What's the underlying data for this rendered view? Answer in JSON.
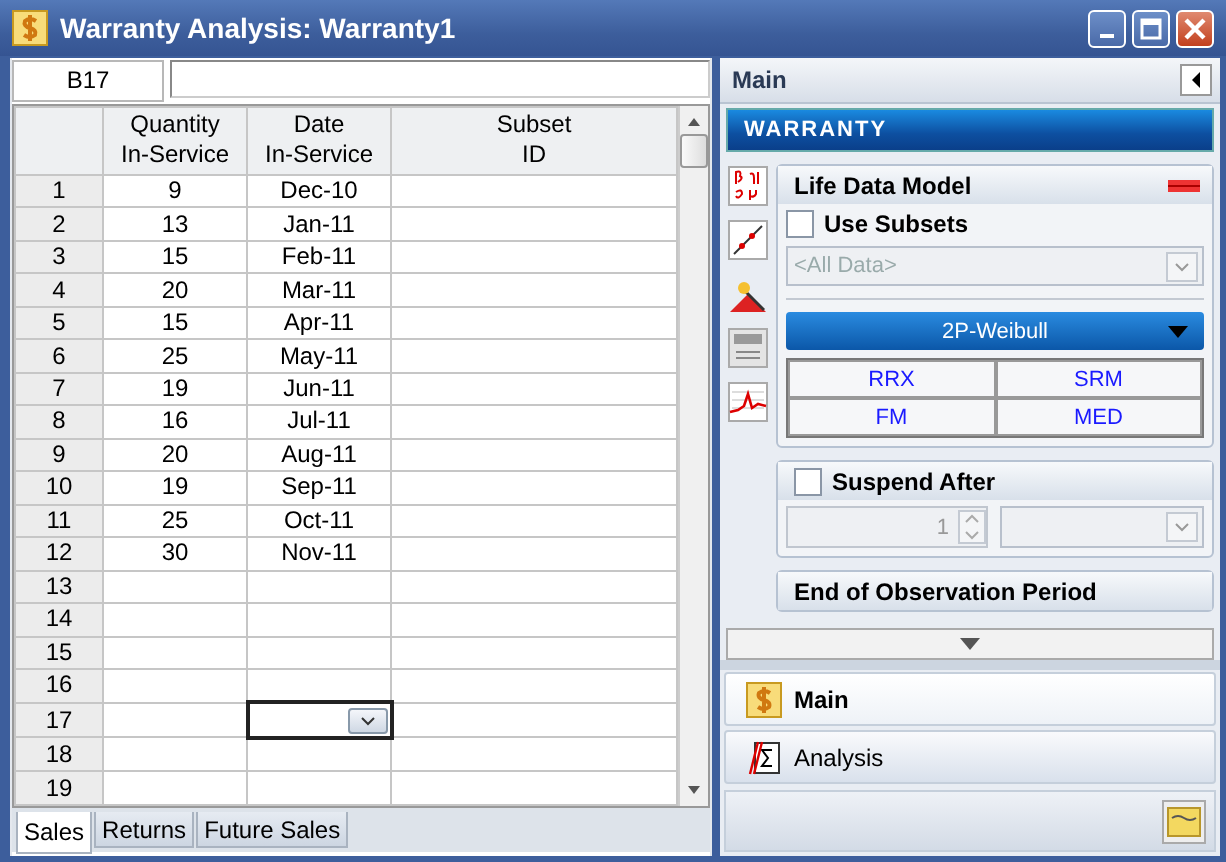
{
  "window": {
    "title": "Warranty Analysis: Warranty1"
  },
  "cell_reference": {
    "name": "B17"
  },
  "table": {
    "columns": [
      {
        "lines": [
          "Quantity",
          "In-Service"
        ]
      },
      {
        "lines": [
          "Date",
          "In-Service"
        ]
      },
      {
        "lines": [
          "Subset",
          "ID"
        ]
      }
    ],
    "rows": [
      {
        "row": "1",
        "quantity": "9",
        "date": "Dec-10",
        "selected": false
      },
      {
        "row": "2",
        "quantity": "13",
        "date": "Jan-11",
        "selected": false
      },
      {
        "row": "3",
        "quantity": "15",
        "date": "Feb-11",
        "selected": false
      },
      {
        "row": "4",
        "quantity": "20",
        "date": "Mar-11",
        "selected": false
      },
      {
        "row": "5",
        "quantity": "15",
        "date": "Apr-11",
        "selected": false
      },
      {
        "row": "6",
        "quantity": "25",
        "date": "May-11",
        "selected": false
      },
      {
        "row": "7",
        "quantity": "19",
        "date": "Jun-11",
        "selected": false
      },
      {
        "row": "8",
        "quantity": "16",
        "date": "Jul-11",
        "selected": false
      },
      {
        "row": "9",
        "quantity": "20",
        "date": "Aug-11",
        "selected": false
      },
      {
        "row": "10",
        "quantity": "19",
        "date": "Sep-11",
        "selected": false
      },
      {
        "row": "11",
        "quantity": "25",
        "date": "Oct-11",
        "selected": false
      },
      {
        "row": "12",
        "quantity": "30",
        "date": "Nov-11",
        "selected": false
      },
      {
        "row": "13",
        "selected": false
      },
      {
        "row": "14",
        "selected": false
      },
      {
        "row": "15",
        "selected": false
      },
      {
        "row": "16",
        "selected": false
      },
      {
        "row": "17",
        "selected": true
      },
      {
        "row": "18",
        "selected": false
      },
      {
        "row": "19",
        "selected": false
      }
    ]
  },
  "sheet_tabs": [
    {
      "label": "Sales",
      "selected": true
    },
    {
      "label": "Returns",
      "selected": false
    },
    {
      "label": "Future Sales",
      "selected": false
    }
  ],
  "panel": {
    "title": "Main",
    "banner": "WARRANTY",
    "life_data_model": {
      "title": "Life Data Model",
      "use_subsets": {
        "label": "Use Subsets",
        "checked": false
      },
      "subset_dropdown": {
        "value": "<All Data>",
        "disabled": true
      },
      "distribution": "2P-Weibull",
      "methods": [
        "RRX",
        "SRM",
        "FM",
        "MED"
      ]
    },
    "suspend_after": {
      "label": "Suspend After",
      "checked": false,
      "value": "1"
    },
    "next_section": {
      "title": "End of Observation Period"
    },
    "nav": [
      {
        "label": "Main",
        "selected": true
      },
      {
        "label": "Analysis",
        "selected": false
      }
    ]
  }
}
